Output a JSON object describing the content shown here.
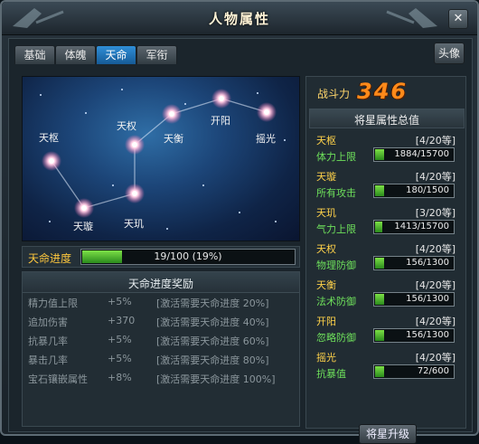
{
  "window": {
    "title": "人物属性",
    "close_icon": "close-icon"
  },
  "tabs": [
    {
      "label": "基础",
      "active": false
    },
    {
      "label": "体魄",
      "active": false
    },
    {
      "label": "天命",
      "active": true
    },
    {
      "label": "军衔",
      "active": false
    }
  ],
  "portrait_button": "头像",
  "constellation": {
    "stars": [
      {
        "name": "天枢"
      },
      {
        "name": "天璇"
      },
      {
        "name": "天玑"
      },
      {
        "name": "天权"
      },
      {
        "name": "天衡"
      },
      {
        "name": "开阳"
      },
      {
        "name": "摇光"
      }
    ]
  },
  "fate_progress": {
    "label": "天命进度",
    "text": "19/100 (19%)",
    "fraction": 0.19
  },
  "rewards": {
    "title": "天命进度奖励",
    "rows": [
      {
        "attr": "精力值上限",
        "value": "+5%",
        "req": "[激活需要天命进度 20%]"
      },
      {
        "attr": "追加伤害",
        "value": "+370",
        "req": "[激活需要天命进度 40%]"
      },
      {
        "attr": "抗暴几率",
        "value": "+5%",
        "req": "[激活需要天命进度 60%]"
      },
      {
        "attr": "暴击几率",
        "value": "+5%",
        "req": "[激活需要天命进度 80%]"
      },
      {
        "attr": "宝石镶嵌属性",
        "value": "+8%",
        "req": "[激活需要天命进度 100%]"
      }
    ]
  },
  "combat_power": {
    "label": "战斗力",
    "value": "346"
  },
  "summary_title": "将星属性总值",
  "star_stats": [
    {
      "name": "天枢",
      "level": "[4/20等]",
      "attr": "体力上限",
      "value": "1884/15700",
      "fraction": 0.12
    },
    {
      "name": "天璇",
      "level": "[4/20等]",
      "attr": "所有攻击",
      "value": "180/1500",
      "fraction": 0.12
    },
    {
      "name": "天玑",
      "level": "[3/20等]",
      "attr": "气力上限",
      "value": "1413/15700",
      "fraction": 0.09
    },
    {
      "name": "天权",
      "level": "[4/20等]",
      "attr": "物理防御",
      "value": "156/1300",
      "fraction": 0.12
    },
    {
      "name": "天衡",
      "level": "[4/20等]",
      "attr": "法术防御",
      "value": "156/1300",
      "fraction": 0.12
    },
    {
      "name": "开阳",
      "level": "[4/20等]",
      "attr": "忽略防御",
      "value": "156/1300",
      "fraction": 0.12
    },
    {
      "name": "摇光",
      "level": "[4/20等]",
      "attr": "抗暴值",
      "value": "72/600",
      "fraction": 0.12
    }
  ],
  "upgrade_button": "将星升级",
  "colors": {
    "accent_tab": "#2f8fd8",
    "gold": "#ffd24a",
    "green": "#6ee05b",
    "power": "#ff8a1a"
  }
}
